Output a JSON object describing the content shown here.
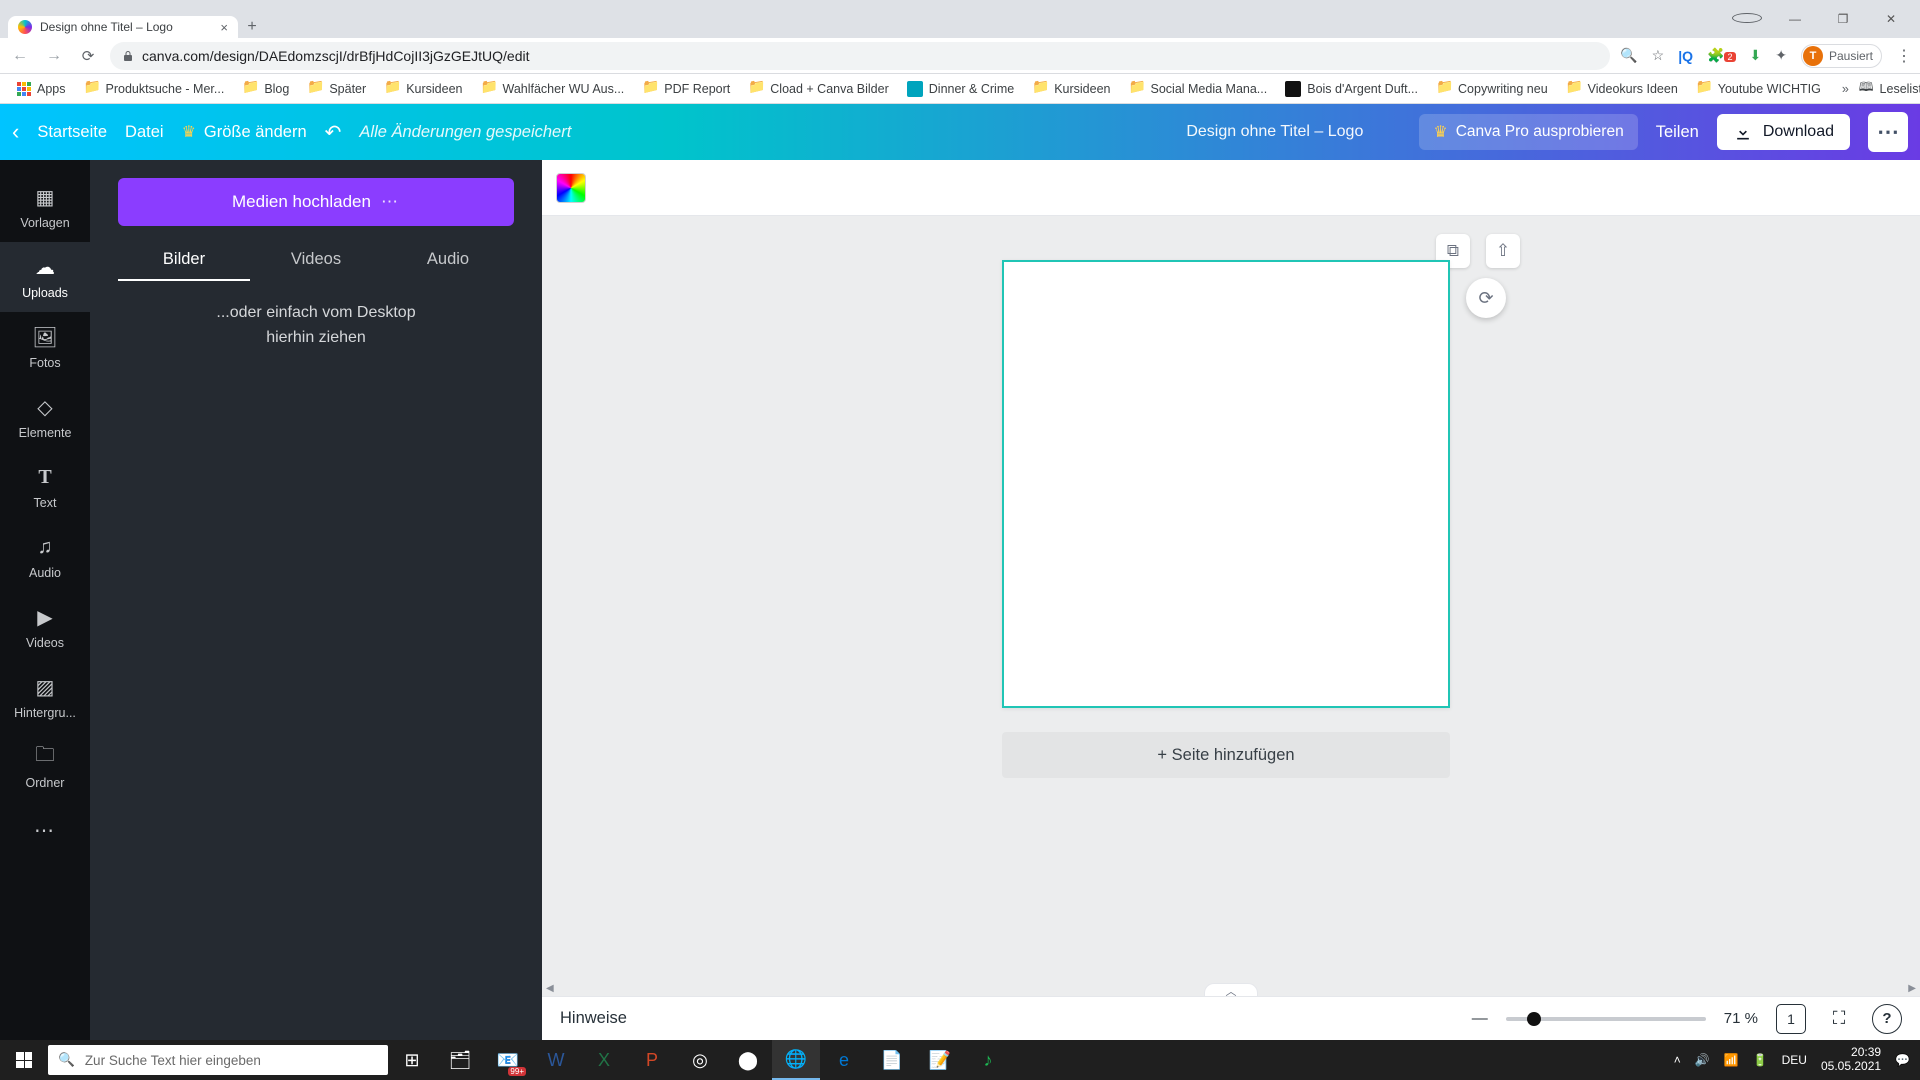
{
  "browser": {
    "tab_title": "Design ohne Titel – Logo",
    "url": "canva.com/design/DAEdomzscjI/drBfjHdCojII3jGzGEJtUQ/edit",
    "profile_status": "Pausiert",
    "profile_initial": "T",
    "bookmarks": [
      {
        "label": "Apps",
        "folder": false
      },
      {
        "label": "Produktsuche - Mer...",
        "folder": true
      },
      {
        "label": "Blog",
        "folder": true
      },
      {
        "label": "Später",
        "folder": true
      },
      {
        "label": "Kursideen",
        "folder": true
      },
      {
        "label": "Wahlfächer WU Aus...",
        "folder": true
      },
      {
        "label": "PDF Report",
        "folder": true
      },
      {
        "label": "Cload + Canva Bilder",
        "folder": true
      },
      {
        "label": "Dinner & Crime",
        "folder": false
      },
      {
        "label": "Kursideen",
        "folder": true
      },
      {
        "label": "Social Media Mana...",
        "folder": true
      },
      {
        "label": "Bois d'Argent Duft...",
        "folder": false
      },
      {
        "label": "Copywriting neu",
        "folder": true
      },
      {
        "label": "Videokurs Ideen",
        "folder": true
      },
      {
        "label": "Youtube WICHTIG",
        "folder": true
      }
    ],
    "reading_list": "Leseliste"
  },
  "header": {
    "home": "Startseite",
    "file": "Datei",
    "resize": "Größe ändern",
    "saved": "Alle Änderungen gespeichert",
    "title": "Design ohne Titel – Logo",
    "try_pro": "Canva Pro ausprobieren",
    "share": "Teilen",
    "download": "Download"
  },
  "rail": {
    "items": [
      {
        "key": "templates",
        "label": "Vorlagen"
      },
      {
        "key": "uploads",
        "label": "Uploads"
      },
      {
        "key": "photos",
        "label": "Fotos"
      },
      {
        "key": "elements",
        "label": "Elemente"
      },
      {
        "key": "text",
        "label": "Text"
      },
      {
        "key": "audio",
        "label": "Audio"
      },
      {
        "key": "videos",
        "label": "Videos"
      },
      {
        "key": "background",
        "label": "Hintergru..."
      },
      {
        "key": "folders",
        "label": "Ordner"
      }
    ]
  },
  "panel": {
    "upload": "Medien hochladen",
    "tabs": {
      "images": "Bilder",
      "videos": "Videos",
      "audio": "Audio"
    },
    "drop_hint_l1": "...oder einfach vom Desktop",
    "drop_hint_l2": "hierhin ziehen"
  },
  "stage": {
    "add_page": "+ Seite hinzufügen"
  },
  "bottom": {
    "hints": "Hinweise",
    "zoom": "71 %",
    "page": "1"
  },
  "taskbar": {
    "search_placeholder": "Zur Suche Text hier eingeben",
    "language": "DEU",
    "time": "20:39",
    "date": "05.05.2021",
    "tray_badge": "99+"
  }
}
